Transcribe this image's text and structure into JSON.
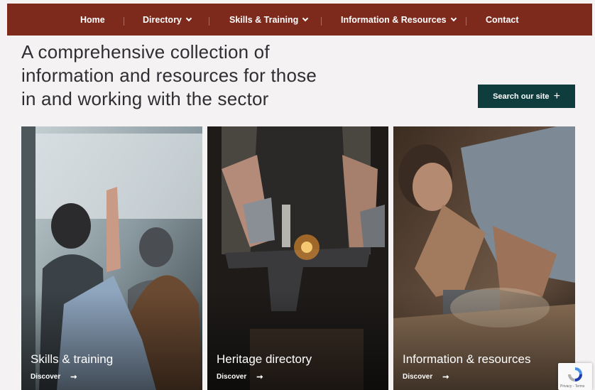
{
  "nav": {
    "items": [
      {
        "label": "Home",
        "has_dropdown": false
      },
      {
        "label": "Directory",
        "has_dropdown": true
      },
      {
        "label": "Skills & Training",
        "has_dropdown": true
      },
      {
        "label": "Information & Resources",
        "has_dropdown": true
      },
      {
        "label": "Contact",
        "has_dropdown": false
      }
    ],
    "background": "#7d2a1d"
  },
  "hero": {
    "headline_line1": "A comprehensive collection of",
    "headline_line2": "information and resources for those",
    "headline_line3": "in and working with the sector",
    "search_button_label": "Search our site",
    "search_button_color": "#0f3d3e"
  },
  "cards": [
    {
      "title": "Skills & training",
      "link_label": "Discover",
      "image": "students-raising-hand-photo"
    },
    {
      "title": "Heritage directory",
      "link_label": "Discover",
      "image": "blacksmith-anvil-sparks-photo"
    },
    {
      "title": "Information & resources",
      "link_label": "Discover",
      "image": "carpenter-grinding-wood-photo"
    }
  ],
  "recaptcha": {
    "text": "Privacy - Terms"
  }
}
